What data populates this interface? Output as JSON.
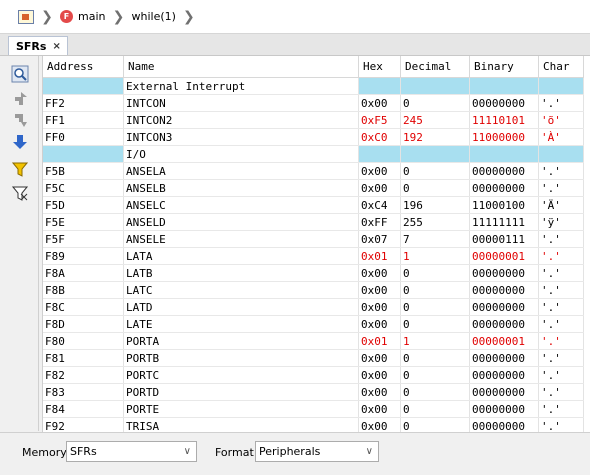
{
  "breadcrumb": {
    "items": [
      "main",
      "while(1)"
    ]
  },
  "tabs": [
    {
      "label": "SFRs",
      "close": "×"
    }
  ],
  "columns": [
    "Address",
    "Name",
    "Hex",
    "Decimal",
    "Binary",
    "Char"
  ],
  "rows": [
    {
      "type": "group",
      "name": "External Interrupt"
    },
    {
      "addr": "FF2",
      "name": "INTCON",
      "hex": "0x00",
      "dec": "0",
      "bin": "00000000",
      "chr": "'.'",
      "changed": false
    },
    {
      "addr": "FF1",
      "name": "INTCON2",
      "hex": "0xF5",
      "dec": "245",
      "bin": "11110101",
      "chr": "'õ'",
      "changed": true
    },
    {
      "addr": "FF0",
      "name": "INTCON3",
      "hex": "0xC0",
      "dec": "192",
      "bin": "11000000",
      "chr": "'À'",
      "changed": true
    },
    {
      "type": "group",
      "name": "I/O"
    },
    {
      "addr": "F5B",
      "name": "ANSELA",
      "hex": "0x00",
      "dec": "0",
      "bin": "00000000",
      "chr": "'.'",
      "changed": false
    },
    {
      "addr": "F5C",
      "name": "ANSELB",
      "hex": "0x00",
      "dec": "0",
      "bin": "00000000",
      "chr": "'.'",
      "changed": false
    },
    {
      "addr": "F5D",
      "name": "ANSELC",
      "hex": "0xC4",
      "dec": "196",
      "bin": "11000100",
      "chr": "'Ä'",
      "changed": false
    },
    {
      "addr": "F5E",
      "name": "ANSELD",
      "hex": "0xFF",
      "dec": "255",
      "bin": "11111111",
      "chr": "'ÿ'",
      "changed": false
    },
    {
      "addr": "F5F",
      "name": "ANSELE",
      "hex": "0x07",
      "dec": "7",
      "bin": "00000111",
      "chr": "'.'",
      "changed": false
    },
    {
      "addr": "F89",
      "name": "LATA",
      "hex": "0x01",
      "dec": "1",
      "bin": "00000001",
      "chr": "'.'",
      "changed": true
    },
    {
      "addr": "F8A",
      "name": "LATB",
      "hex": "0x00",
      "dec": "0",
      "bin": "00000000",
      "chr": "'.'",
      "changed": false
    },
    {
      "addr": "F8B",
      "name": "LATC",
      "hex": "0x00",
      "dec": "0",
      "bin": "00000000",
      "chr": "'.'",
      "changed": false
    },
    {
      "addr": "F8C",
      "name": "LATD",
      "hex": "0x00",
      "dec": "0",
      "bin": "00000000",
      "chr": "'.'",
      "changed": false
    },
    {
      "addr": "F8D",
      "name": "LATE",
      "hex": "0x00",
      "dec": "0",
      "bin": "00000000",
      "chr": "'.'",
      "changed": false
    },
    {
      "addr": "F80",
      "name": "PORTA",
      "hex": "0x01",
      "dec": "1",
      "bin": "00000001",
      "chr": "'.'",
      "changed": true
    },
    {
      "addr": "F81",
      "name": "PORTB",
      "hex": "0x00",
      "dec": "0",
      "bin": "00000000",
      "chr": "'.'",
      "changed": false
    },
    {
      "addr": "F82",
      "name": "PORTC",
      "hex": "0x00",
      "dec": "0",
      "bin": "00000000",
      "chr": "'.'",
      "changed": false
    },
    {
      "addr": "F83",
      "name": "PORTD",
      "hex": "0x00",
      "dec": "0",
      "bin": "00000000",
      "chr": "'.'",
      "changed": false
    },
    {
      "addr": "F84",
      "name": "PORTE",
      "hex": "0x00",
      "dec": "0",
      "bin": "00000000",
      "chr": "'.'",
      "changed": false
    },
    {
      "addr": "F92",
      "name": "TRISA",
      "hex": "0x00",
      "dec": "0",
      "bin": "00000000",
      "chr": "'.'",
      "changed": false
    }
  ],
  "bottom": {
    "memory_label": "Memory",
    "memory_value": "SFRs",
    "format_label": "Format",
    "format_value": "Peripherals"
  },
  "colors": {
    "changed": "#e00000",
    "group_row": "#a8dff0"
  }
}
